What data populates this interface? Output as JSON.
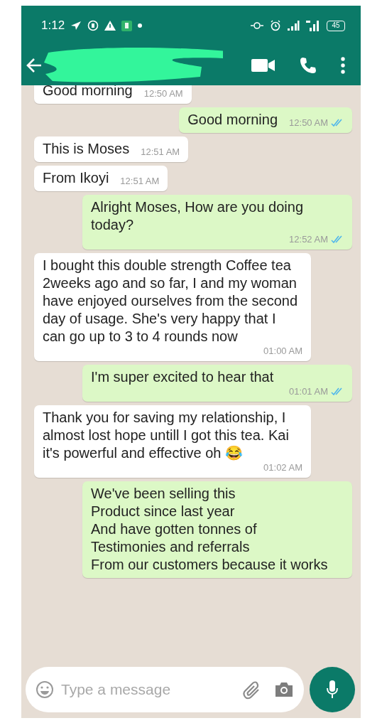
{
  "status_bar": {
    "time": "1:12",
    "battery": "45"
  },
  "header": {
    "name_redacted": true
  },
  "messages": [
    {
      "kind": "in",
      "text": "Good morning",
      "time": "12:50 AM"
    },
    {
      "kind": "out",
      "text": "Good morning",
      "time": "12:50 AM",
      "read": true
    },
    {
      "kind": "in",
      "text": "This is Moses",
      "time": "12:51 AM"
    },
    {
      "kind": "in",
      "text": "From Ikoyi",
      "time": "12:51 AM"
    },
    {
      "kind": "out",
      "text": "Alright Moses, How are you doing today?",
      "time": "12:52 AM",
      "read": true
    },
    {
      "kind": "in",
      "text": "I bought this double strength Coffee tea 2weeks ago and so far, I and my woman have enjoyed ourselves from the second day of usage. She's very happy that I can go up to 3 to 4 rounds now",
      "time": "01:00 AM"
    },
    {
      "kind": "out",
      "text": "I'm super excited to hear that",
      "time": "01:01 AM",
      "read": true
    },
    {
      "kind": "in",
      "text": "Thank you for saving my relationship, I almost lost hope untill I got this tea. Kai it's powerful and effective oh 😂",
      "time": "01:02 AM"
    },
    {
      "kind": "out",
      "text": "We've been selling this\nProduct since last year\nAnd have gotten tonnes of\nTestimonies and referrals\nFrom our customers because it works"
    }
  ],
  "composer": {
    "placeholder": "Type a message"
  }
}
